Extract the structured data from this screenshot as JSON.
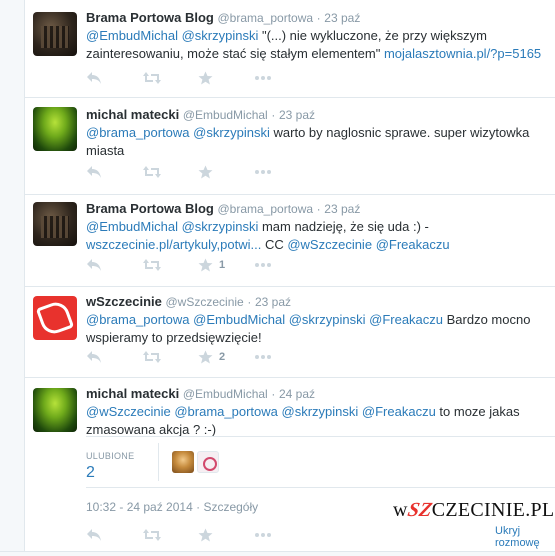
{
  "tweets": [
    {
      "name": "Brama Portowa Blog",
      "handle": "@brama_portowa",
      "sep": "·",
      "time": "23 paź",
      "text_parts": [
        {
          "t": "@EmbudMichal",
          "type": "mention"
        },
        {
          "t": " ",
          "type": "text"
        },
        {
          "t": "@skrzypinski",
          "type": "mention"
        },
        {
          "t": " \"(...) nie wykluczone, że przy większym zainteresowaniu, może stać się stałym elementem\" ",
          "type": "text"
        },
        {
          "t": "mojalasztownia.pl/?p=5165",
          "type": "link"
        }
      ],
      "retweets": "",
      "favorites": ""
    },
    {
      "name": "michal matecki",
      "handle": "@EmbudMichal",
      "sep": "·",
      "time": "23 paź",
      "text_parts": [
        {
          "t": "@brama_portowa",
          "type": "mention"
        },
        {
          "t": " ",
          "type": "text"
        },
        {
          "t": "@skrzypinski",
          "type": "mention"
        },
        {
          "t": " warto by naglosnic sprawe. super wizytowka miasta",
          "type": "text"
        }
      ],
      "retweets": "",
      "favorites": ""
    },
    {
      "name": "Brama Portowa Blog",
      "handle": "@brama_portowa",
      "sep": "·",
      "time": "23 paź",
      "text_parts": [
        {
          "t": "@EmbudMichal",
          "type": "mention"
        },
        {
          "t": " ",
          "type": "text"
        },
        {
          "t": "@skrzypinski",
          "type": "mention"
        },
        {
          "t": " mam nadzieję, że się uda :) - ",
          "type": "text"
        },
        {
          "t": "wszczecinie.pl/artykuly,potwi...",
          "type": "link"
        },
        {
          "t": " CC ",
          "type": "text"
        },
        {
          "t": "@wSzczecinie",
          "type": "mention"
        },
        {
          "t": " ",
          "type": "text"
        },
        {
          "t": "@Freakaczu",
          "type": "mention"
        }
      ],
      "retweets": "",
      "favorites": "1"
    },
    {
      "name": "wSzczecinie",
      "handle": "@wSzczecinie",
      "sep": "·",
      "time": "23 paź",
      "text_parts": [
        {
          "t": "@brama_portowa",
          "type": "mention"
        },
        {
          "t": " ",
          "type": "text"
        },
        {
          "t": "@EmbudMichal",
          "type": "mention"
        },
        {
          "t": " ",
          "type": "text"
        },
        {
          "t": "@skrzypinski",
          "type": "mention"
        },
        {
          "t": " ",
          "type": "text"
        },
        {
          "t": "@Freakaczu",
          "type": "mention"
        },
        {
          "t": " Bardzo mocno wspieramy to przedsięwzięcie!",
          "type": "text"
        }
      ],
      "retweets": "",
      "favorites": "2"
    },
    {
      "name": "michal matecki",
      "handle": "@EmbudMichal",
      "sep": "·",
      "time": "24 paź",
      "text_parts": [
        {
          "t": "@wSzczecinie",
          "type": "mention"
        },
        {
          "t": " ",
          "type": "text"
        },
        {
          "t": "@brama_portowa",
          "type": "mention"
        },
        {
          "t": " ",
          "type": "text"
        },
        {
          "t": "@skrzypinski",
          "type": "mention"
        },
        {
          "t": " ",
          "type": "text"
        },
        {
          "t": "@Freakaczu",
          "type": "mention"
        },
        {
          "t": " to moze jakas zmasowana akcja ? :-)",
          "type": "text"
        }
      ],
      "retweets": "",
      "favorites": ""
    }
  ],
  "detail": {
    "favorites_label": "ULUBIONE",
    "favorites_count": "2",
    "timestamp": "10:32 - 24 paź 2014",
    "sep": "·",
    "details_link": "Szczegóły",
    "hide_conversation": "Ukryj rozmowę",
    "brand_prefix": "w",
    "brand_sz": "SZ",
    "brand_suffix": "CZECINIE.PL"
  },
  "icons": {
    "reply": "reply-icon",
    "retweet": "retweet-icon",
    "favorite": "star-icon",
    "more": "more-icon"
  },
  "colors": {
    "link": "#2b7bb9",
    "muted": "#8899a6",
    "icon": "#ccd6dd",
    "border": "#e1e8ed",
    "brand_red": "#e8322d"
  }
}
